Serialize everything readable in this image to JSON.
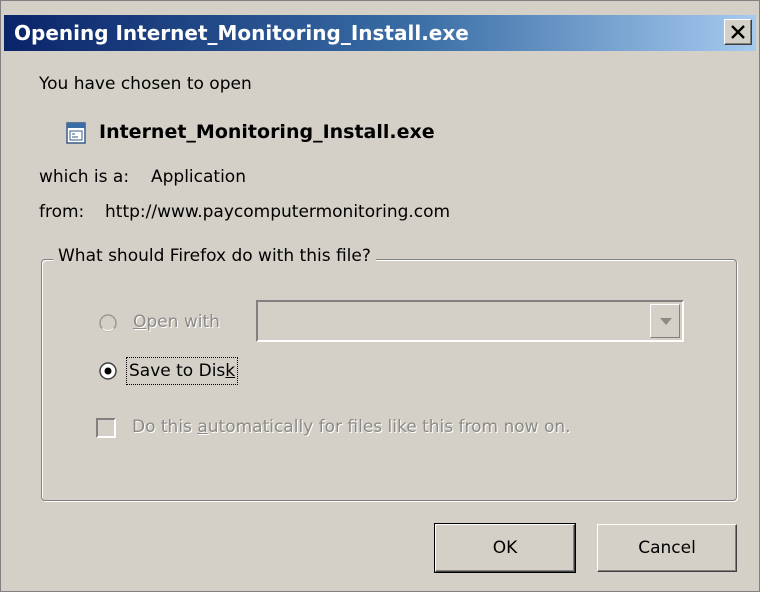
{
  "window": {
    "title": "Opening Internet_Monitoring_Install.exe",
    "close_icon": "close-x-icon"
  },
  "intro": {
    "chosen_text": "You have chosen to open",
    "file_icon": "application-file-icon",
    "filename": "Internet_Monitoring_Install.exe",
    "type_label": "which is a:",
    "type_value": "Application",
    "from_label": "from:",
    "from_value": "http://www.paycomputermonitoring.com"
  },
  "group": {
    "legend": "What should Firefox do with this file?",
    "open_with": {
      "accesskey": "O",
      "label_rest": "pen with",
      "selected": false,
      "disabled": true,
      "combo_value": ""
    },
    "save_to_disk": {
      "label_before": "Save to Dis",
      "accesskey": "k",
      "label_after": "",
      "selected": true
    },
    "auto_checkbox": {
      "label_before": "Do this ",
      "accesskey": "a",
      "label_after": "utomatically for files like this from now on.",
      "checked": false,
      "disabled": true
    }
  },
  "buttons": {
    "ok": "OK",
    "cancel": "Cancel"
  },
  "colors": {
    "title_bar_start": "#0a246a",
    "title_bar_end": "#a6caf0",
    "dialog_face": "#d4d0c8",
    "disabled_text": "#8c8a86"
  }
}
